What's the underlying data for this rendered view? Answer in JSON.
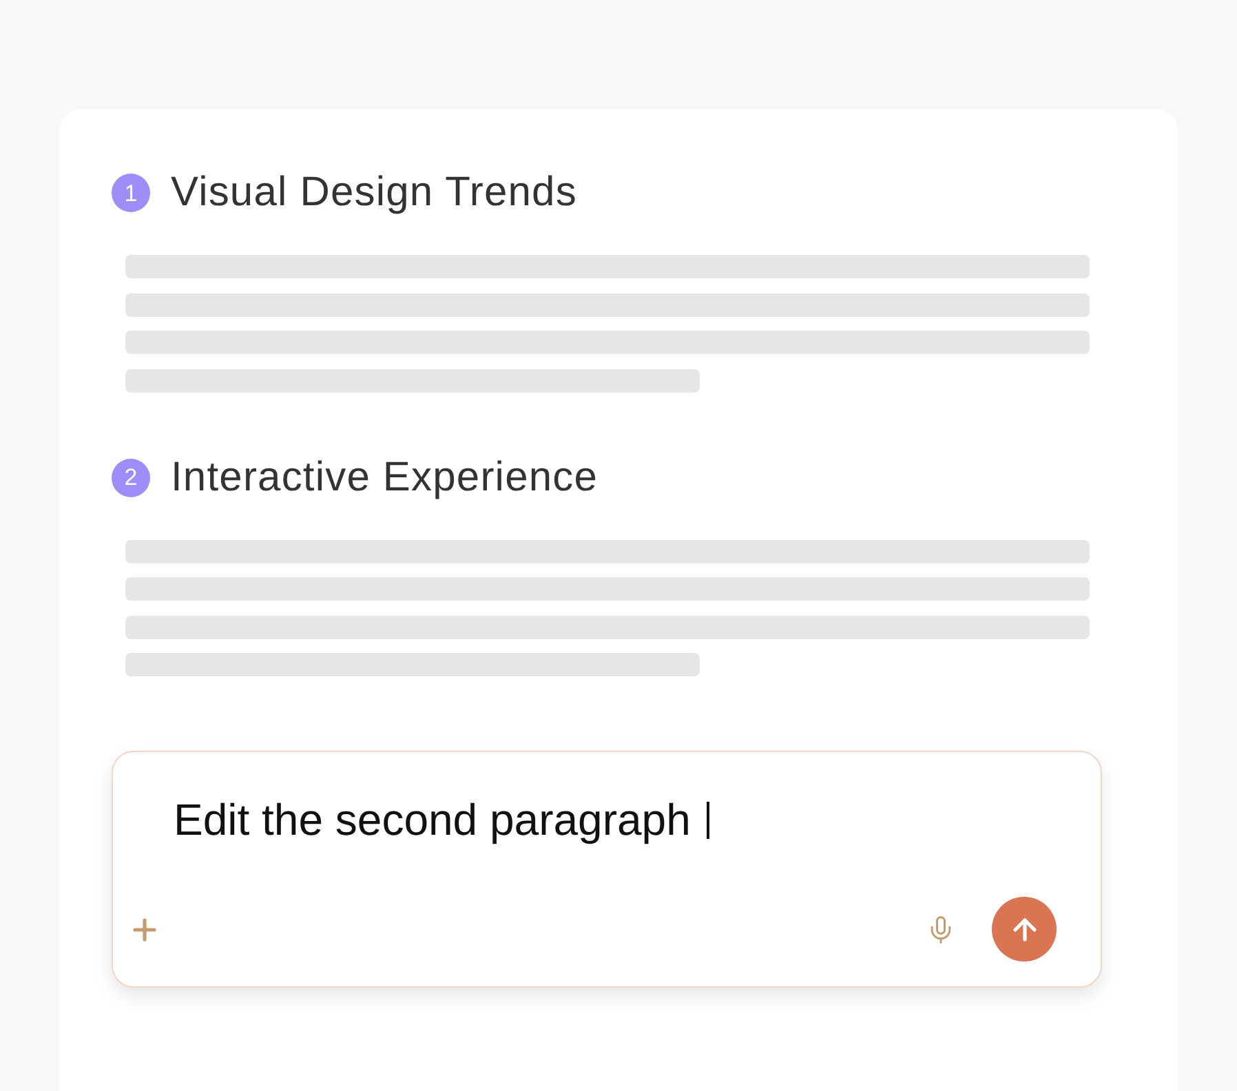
{
  "sections": [
    {
      "number": "1",
      "title": "Visual Design Trends"
    },
    {
      "number": "2",
      "title": "Interactive Experience"
    }
  ],
  "prompt_box": {
    "value": "Edit the second paragraph",
    "focused": true
  }
}
